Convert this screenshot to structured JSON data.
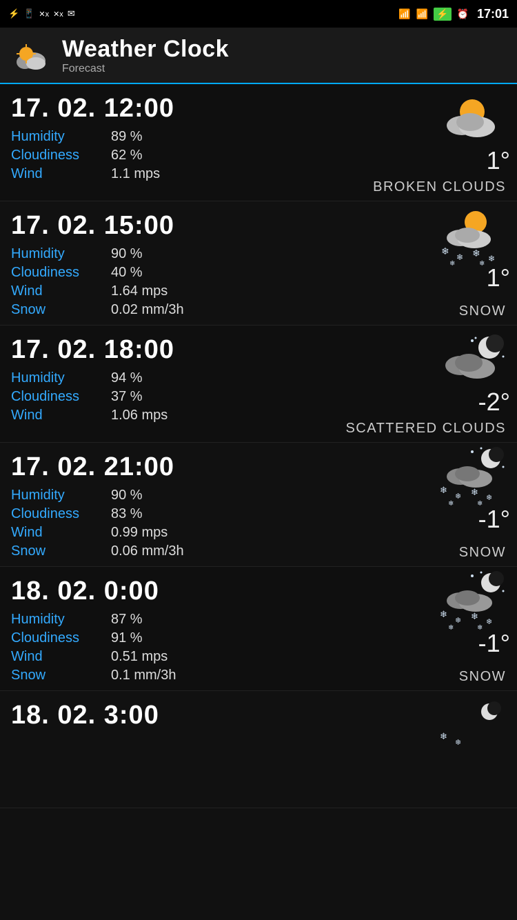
{
  "statusBar": {
    "time": "17:01",
    "icons_left": [
      "usb",
      "sim",
      "signal-x",
      "signal-x",
      "mail"
    ],
    "icons_right": [
      "wifi",
      "signal",
      "battery",
      "alarm"
    ]
  },
  "header": {
    "title": "Weather Clock",
    "subtitle": "Forecast"
  },
  "forecasts": [
    {
      "datetime": "17. 02. 12:00",
      "humidity": "89 %",
      "cloudiness": "62 %",
      "wind": "1.1 mps",
      "snow": null,
      "temperature": "1°",
      "description": "BROKEN CLOUDS",
      "icon": "broken-clouds-day"
    },
    {
      "datetime": "17. 02. 15:00",
      "humidity": "90 %",
      "cloudiness": "40 %",
      "wind": "1.64 mps",
      "snow": "0.02 mm/3h",
      "temperature": "1°",
      "description": "SNOW",
      "icon": "snow-day"
    },
    {
      "datetime": "17. 02. 18:00",
      "humidity": "94 %",
      "cloudiness": "37 %",
      "wind": "1.06 mps",
      "snow": null,
      "temperature": "-2°",
      "description": "SCATTERED CLOUDS",
      "icon": "scattered-clouds-night"
    },
    {
      "datetime": "17. 02. 21:00",
      "humidity": "90 %",
      "cloudiness": "83 %",
      "wind": "0.99 mps",
      "snow": "0.06 mm/3h",
      "temperature": "-1°",
      "description": "SNOW",
      "icon": "snow-night"
    },
    {
      "datetime": "18. 02. 0:00",
      "humidity": "87 %",
      "cloudiness": "91 %",
      "wind": "0.51 mps",
      "snow": "0.1 mm/3h",
      "temperature": "-1°",
      "description": "SNOW",
      "icon": "snow-night"
    },
    {
      "datetime": "18. 02. 3:00",
      "humidity": null,
      "cloudiness": null,
      "wind": null,
      "snow": null,
      "temperature": "",
      "description": "",
      "icon": "snow-night-partial"
    }
  ],
  "labels": {
    "humidity": "Humidity",
    "cloudiness": "Cloudiness",
    "wind": "Wind",
    "snow": "Snow"
  }
}
